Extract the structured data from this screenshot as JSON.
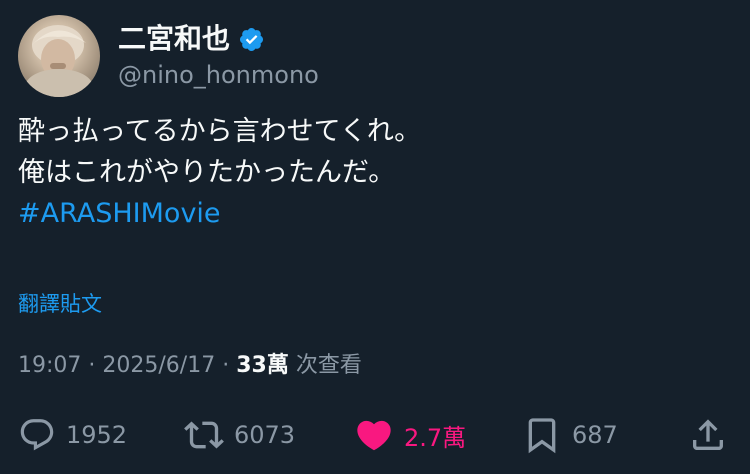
{
  "user": {
    "display_name": "二宮和也",
    "handle": "@nino_honmono",
    "verified": true
  },
  "tweet": {
    "lines": [
      "酔っ払ってるから言わせてくれ。",
      "俺はこれがやりたかったんだ。"
    ],
    "hashtag": "#ARASHIMovie"
  },
  "translate_label": "翻譯貼文",
  "meta": {
    "time": "19:07",
    "separator": "·",
    "date": "2025/6/17",
    "views_count": "33萬",
    "views_label": "次查看"
  },
  "actions": {
    "replies": "1952",
    "retweets": "6073",
    "likes": "2.7萬",
    "bookmarks": "687"
  },
  "colors": {
    "background": "#15202b",
    "accent": "#1d9bf0",
    "like": "#f91880",
    "secondary_text": "#8b98a5"
  }
}
